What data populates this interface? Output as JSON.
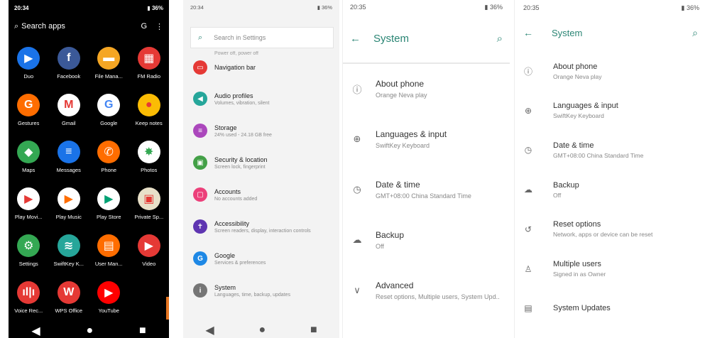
{
  "panel1": {
    "status": {
      "time": "20:34",
      "battery": "36%"
    },
    "search_label": "Search apps",
    "apps": [
      {
        "name": "Duo",
        "color": "#1a73e8",
        "glyph": "▶"
      },
      {
        "name": "Facebook",
        "color": "#3b5998",
        "glyph": "f"
      },
      {
        "name": "File Mana...",
        "color": "#f5a623",
        "glyph": "▬"
      },
      {
        "name": "FM Radio",
        "color": "#e53935",
        "glyph": "▦"
      },
      {
        "name": "Gestures",
        "color": "#ff6d00",
        "glyph": "G"
      },
      {
        "name": "Gmail",
        "color": "#ffffff",
        "glyph": "M"
      },
      {
        "name": "Google",
        "color": "#ffffff",
        "glyph": "G"
      },
      {
        "name": "Keep notes",
        "color": "#fbbc04",
        "glyph": "●"
      },
      {
        "name": "Maps",
        "color": "#34a853",
        "glyph": "◆"
      },
      {
        "name": "Messages",
        "color": "#1a73e8",
        "glyph": "≡"
      },
      {
        "name": "Phone",
        "color": "#ff6d00",
        "glyph": "✆"
      },
      {
        "name": "Photos",
        "color": "#ffffff",
        "glyph": "✸"
      },
      {
        "name": "Play Movi...",
        "color": "#ffffff",
        "glyph": "▶"
      },
      {
        "name": "Play Music",
        "color": "#ffffff",
        "glyph": "▶"
      },
      {
        "name": "Play Store",
        "color": "#ffffff",
        "glyph": "▶"
      },
      {
        "name": "Private Sp...",
        "color": "#e8e0c8",
        "glyph": "▣"
      },
      {
        "name": "Settings",
        "color": "#34a853",
        "glyph": "⚙"
      },
      {
        "name": "SwiftKey K...",
        "color": "#26a69a",
        "glyph": "≋"
      },
      {
        "name": "User Man...",
        "color": "#ff6d00",
        "glyph": "▤"
      },
      {
        "name": "Video",
        "color": "#e53935",
        "glyph": "▶"
      },
      {
        "name": "Voice Rec...",
        "color": "#e53935",
        "glyph": "ıl|ı"
      },
      {
        "name": "WPS Office",
        "color": "#e53935",
        "glyph": "W"
      },
      {
        "name": "YouTube",
        "color": "#ff0000",
        "glyph": "▶"
      }
    ]
  },
  "panel2": {
    "status": {
      "time": "20:34",
      "battery": "36%"
    },
    "search_placeholder": "Search in Settings",
    "cut_text": "Power off, power off",
    "items": [
      {
        "title": "Navigation bar",
        "subtitle": "",
        "color": "#e53935",
        "glyph": "▭"
      },
      {
        "title": "Audio profiles",
        "subtitle": "Volumes, vibration, silent",
        "color": "#26a69a",
        "glyph": "◀"
      },
      {
        "title": "Storage",
        "subtitle": "24% used - 24.18 GB free",
        "color": "#ab47bc",
        "glyph": "≡"
      },
      {
        "title": "Security & location",
        "subtitle": "Screen lock, fingerprint",
        "color": "#43a047",
        "glyph": "▣"
      },
      {
        "title": "Accounts",
        "subtitle": "No accounts added",
        "color": "#ec407a",
        "glyph": "▢"
      },
      {
        "title": "Accessibility",
        "subtitle": "Screen readers, display, interaction controls",
        "color": "#5e35b1",
        "glyph": "✝"
      },
      {
        "title": "Google",
        "subtitle": "Services & preferences",
        "color": "#1e88e5",
        "glyph": "G"
      },
      {
        "title": "System",
        "subtitle": "Languages, time, backup, updates",
        "color": "#757575",
        "glyph": "i"
      }
    ]
  },
  "panel3": {
    "status": {
      "time": "20:35",
      "battery": "36%"
    },
    "title": "System",
    "items": [
      {
        "title": "About phone",
        "subtitle": "Orange Neva play",
        "icon": "ⓘ"
      },
      {
        "title": "Languages & input",
        "subtitle": "SwiftKey Keyboard",
        "icon": "⊕"
      },
      {
        "title": "Date & time",
        "subtitle": "GMT+08:00 China Standard Time",
        "icon": "◷"
      },
      {
        "title": "Backup",
        "subtitle": "Off",
        "icon": "☁"
      },
      {
        "title": "Advanced",
        "subtitle": "Reset options, Multiple users, System Upd..",
        "icon": "∨"
      }
    ]
  },
  "panel4": {
    "status": {
      "time": "20:35",
      "battery": "36%"
    },
    "title": "System",
    "items": [
      {
        "title": "About phone",
        "subtitle": "Orange Neva play",
        "icon": "ⓘ"
      },
      {
        "title": "Languages & input",
        "subtitle": "SwiftKey Keyboard",
        "icon": "⊕"
      },
      {
        "title": "Date & time",
        "subtitle": "GMT+08:00 China Standard Time",
        "icon": "◷"
      },
      {
        "title": "Backup",
        "subtitle": "Off",
        "icon": "☁"
      },
      {
        "title": "Reset options",
        "subtitle": "Network, apps or device can be reset",
        "icon": "↺"
      },
      {
        "title": "Multiple users",
        "subtitle": "Signed in as Owner",
        "icon": "♙"
      },
      {
        "title": "System Updates",
        "subtitle": "",
        "icon": "▤"
      }
    ]
  }
}
